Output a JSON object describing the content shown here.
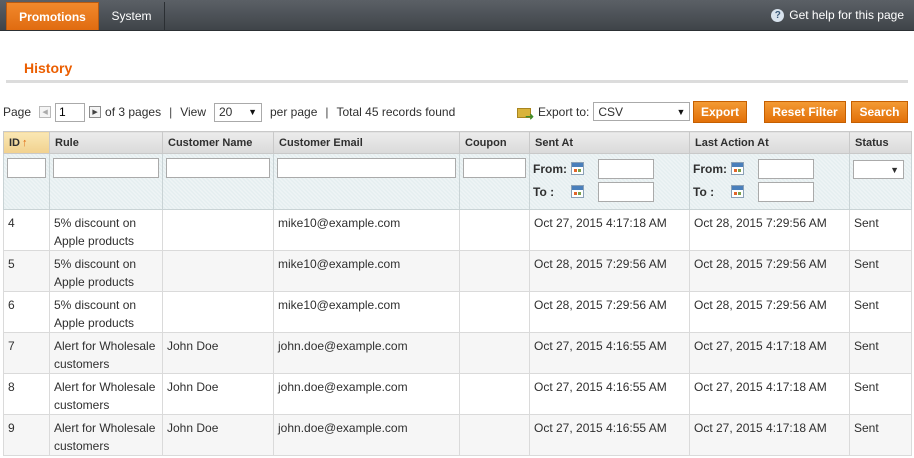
{
  "nav": {
    "tabs": [
      {
        "label": "Promotions"
      },
      {
        "label": "System"
      }
    ],
    "help_label": "Get help for this page",
    "help_icon": "question-circle-icon"
  },
  "page": {
    "title": "History"
  },
  "pager": {
    "page_label": "Page",
    "current_page": "1",
    "of_pages": "of 3 pages",
    "view_label": "View",
    "per_page_value": "20",
    "per_page_label": "per page",
    "total_label": "Total 45 records found"
  },
  "export": {
    "label": "Export to:",
    "format": "CSV",
    "export_button": "Export",
    "reset_button": "Reset Filter",
    "search_button": "Search"
  },
  "grid": {
    "columns": [
      {
        "label": "ID"
      },
      {
        "label": "Rule"
      },
      {
        "label": "Customer Name"
      },
      {
        "label": "Customer Email"
      },
      {
        "label": "Coupon"
      },
      {
        "label": "Sent At"
      },
      {
        "label": "Last Action At"
      },
      {
        "label": "Status"
      }
    ],
    "sort_arrow": "↑",
    "filter": {
      "from_label": "From:",
      "to_label": "To :"
    },
    "rows": [
      {
        "id": "4",
        "rule": "5% discount on Apple products",
        "name": "",
        "email": "mike10@example.com",
        "coupon": "",
        "sent_at": "Oct 27, 2015 4:17:18 AM",
        "last_action": "Oct 28, 2015 7:29:56 AM",
        "status": "Sent"
      },
      {
        "id": "5",
        "rule": "5% discount on Apple products",
        "name": "",
        "email": "mike10@example.com",
        "coupon": "",
        "sent_at": "Oct 28, 2015 7:29:56 AM",
        "last_action": "Oct 28, 2015 7:29:56 AM",
        "status": "Sent"
      },
      {
        "id": "6",
        "rule": "5% discount on Apple products",
        "name": "",
        "email": "mike10@example.com",
        "coupon": "",
        "sent_at": "Oct 28, 2015 7:29:56 AM",
        "last_action": "Oct 28, 2015 7:29:56 AM",
        "status": "Sent"
      },
      {
        "id": "7",
        "rule": "Alert for Wholesale customers",
        "name": "John Doe",
        "email": "john.doe@example.com",
        "coupon": "",
        "sent_at": "Oct 27, 2015 4:16:55 AM",
        "last_action": "Oct 27, 2015 4:17:18 AM",
        "status": "Sent"
      },
      {
        "id": "8",
        "rule": "Alert for Wholesale customers",
        "name": "John Doe",
        "email": "john.doe@example.com",
        "coupon": "",
        "sent_at": "Oct 27, 2015 4:16:55 AM",
        "last_action": "Oct 27, 2015 4:17:18 AM",
        "status": "Sent"
      },
      {
        "id": "9",
        "rule": "Alert for Wholesale customers",
        "name": "John Doe",
        "email": "john.doe@example.com",
        "coupon": "",
        "sent_at": "Oct 27, 2015 4:16:55 AM",
        "last_action": "Oct 27, 2015 4:17:18 AM",
        "status": "Sent"
      }
    ]
  }
}
